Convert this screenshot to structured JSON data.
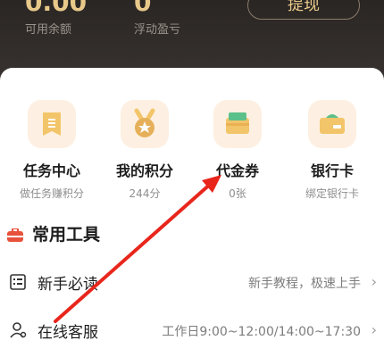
{
  "header": {
    "balance_value": "0.00",
    "balance_label": "可用余额",
    "floating_value": "0",
    "floating_label": "浮动盈亏",
    "withdraw_label": "提现"
  },
  "features": [
    {
      "title": "任务中心",
      "subtitle": "做任务赚积分",
      "icon": "task-center-icon"
    },
    {
      "title": "我的积分",
      "subtitle": "244分",
      "icon": "points-medal-icon"
    },
    {
      "title": "代金券",
      "subtitle": "0张",
      "icon": "voucher-icon"
    },
    {
      "title": "银行卡",
      "subtitle": "绑定银行卡",
      "icon": "bank-card-icon"
    }
  ],
  "tools": {
    "title": "常用工具",
    "icon": "toolbox-icon",
    "rows": [
      {
        "title": "新手必读",
        "desc": "新手教程，极速上手",
        "icon": "guide-icon"
      },
      {
        "title": "在线客服",
        "desc": "工作日9:00~12:00/14:00~17:30",
        "icon": "customer-service-icon"
      }
    ]
  },
  "colors": {
    "header_bg": "#2a2624",
    "gold": "#e9c98a",
    "icon_bg": "#fdf0e2",
    "accent_red": "#e8523b",
    "annotation_arrow": "#e8261c"
  }
}
